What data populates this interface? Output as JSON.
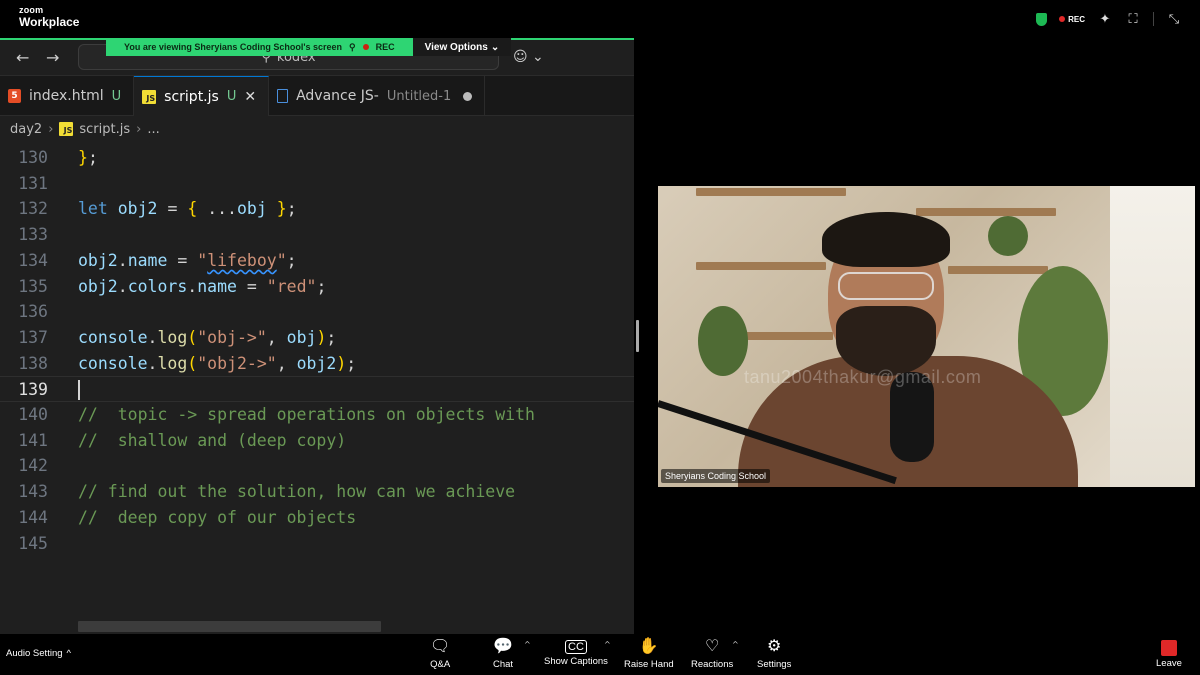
{
  "zoom": {
    "brand_small": "zoom",
    "brand_large": "Workplace",
    "rec_label": "REC",
    "icons": [
      "shield-icon",
      "sparkle-icon",
      "layout-icon",
      "minimize-icon"
    ]
  },
  "share_banner": {
    "text": "You are viewing  Sheryians Coding School's screen",
    "rec_label": "REC",
    "view_options": "View Options",
    "color": "#2ed573"
  },
  "vscode": {
    "search_text": "kodex",
    "tabs": [
      {
        "label": "index.html",
        "status": "U"
      },
      {
        "label": "script.js",
        "status": "U"
      },
      {
        "label": "Advance JS-",
        "status": "Untitled-1"
      }
    ],
    "breadcrumb": {
      "folder": "day2",
      "file": "script.js",
      "more": "..."
    },
    "lines": [
      {
        "num": "130",
        "code": "};"
      },
      {
        "num": "131",
        "code": ""
      },
      {
        "num": "132",
        "code": "let obj2 = { ...obj };"
      },
      {
        "num": "133",
        "code": ""
      },
      {
        "num": "134",
        "code": "obj2.name = \"lifeboy\";"
      },
      {
        "num": "135",
        "code": "obj2.colors.name = \"red\";"
      },
      {
        "num": "136",
        "code": ""
      },
      {
        "num": "137",
        "code": "console.log(\"obj->\", obj);"
      },
      {
        "num": "138",
        "code": "console.log(\"obj2->\", obj2);"
      },
      {
        "num": "139",
        "code": ""
      },
      {
        "num": "140",
        "code": "//  topic -> spread operations on objects with"
      },
      {
        "num": "141",
        "code": "//  shallow and (deep copy)"
      },
      {
        "num": "142",
        "code": ""
      },
      {
        "num": "143",
        "code": "// find out the solution, how can we achieve"
      },
      {
        "num": "144",
        "code": "//  deep copy of our objects"
      },
      {
        "num": "145",
        "code": ""
      }
    ]
  },
  "video": {
    "participant_name": "Sheryians Coding School",
    "watermark": "tanu2004thakur@gmail.com"
  },
  "toolbar": {
    "audio_setting": "Audio Setting",
    "items": [
      "Q&A",
      "Chat",
      "Show Captions",
      "Raise Hand",
      "Reactions",
      "Settings"
    ],
    "leave": "Leave"
  }
}
